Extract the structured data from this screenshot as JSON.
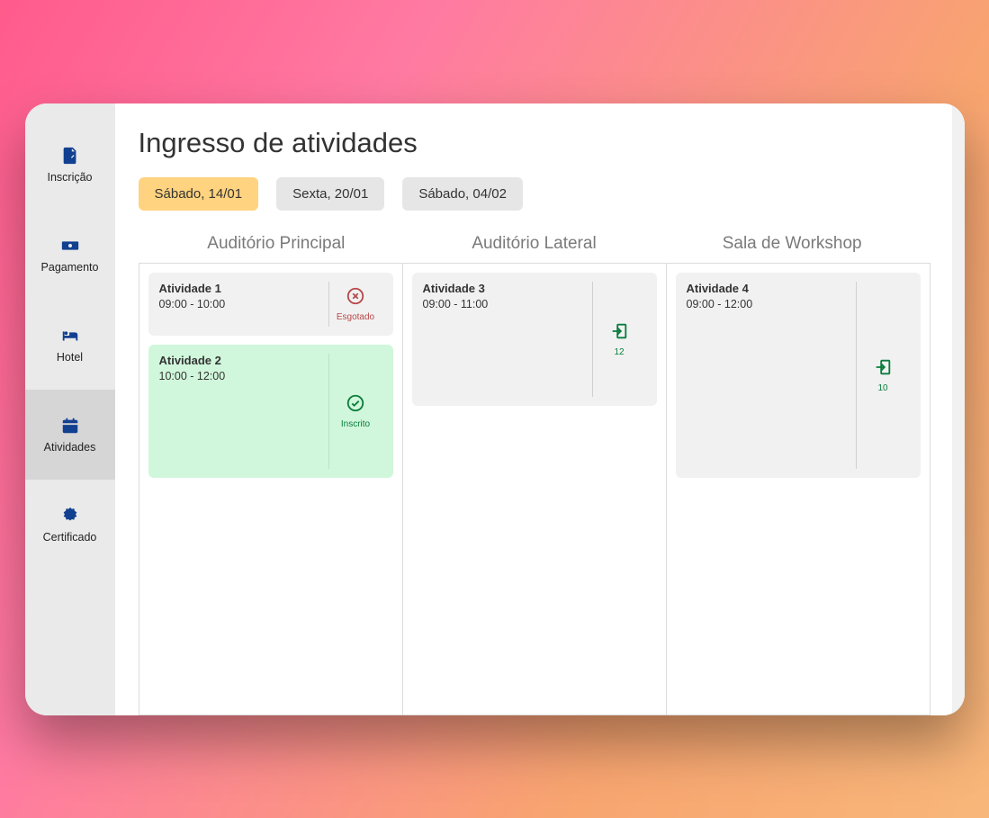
{
  "sidebar": {
    "items": [
      {
        "label": "Inscrição"
      },
      {
        "label": "Pagamento"
      },
      {
        "label": "Hotel"
      },
      {
        "label": "Atividades"
      },
      {
        "label": "Certificado"
      }
    ]
  },
  "page_title": "Ingresso de atividades",
  "date_tabs": [
    {
      "label": "Sábado, 14/01",
      "active": true
    },
    {
      "label": "Sexta, 20/01",
      "active": false
    },
    {
      "label": "Sábado, 04/02",
      "active": false
    }
  ],
  "rooms": [
    {
      "name": "Auditório Principal",
      "activities": [
        {
          "title": "Atividade 1",
          "time": "09:00 - 10:00",
          "status": "sold_out",
          "status_label": "Esgotado",
          "height": 1
        },
        {
          "title": "Atividade 2",
          "time": "10:00 - 12:00",
          "status": "enrolled",
          "status_label": "Inscrito",
          "height": 2
        }
      ]
    },
    {
      "name": "Auditório Lateral",
      "activities": [
        {
          "title": "Atividade 3",
          "time": "09:00 - 11:00",
          "status": "available",
          "status_label": "12",
          "height": 2
        }
      ]
    },
    {
      "name": "Sala de Workshop",
      "activities": [
        {
          "title": "Atividade 4",
          "time": "09:00 - 12:00",
          "status": "available",
          "status_label": "10",
          "height": 3
        }
      ]
    }
  ]
}
